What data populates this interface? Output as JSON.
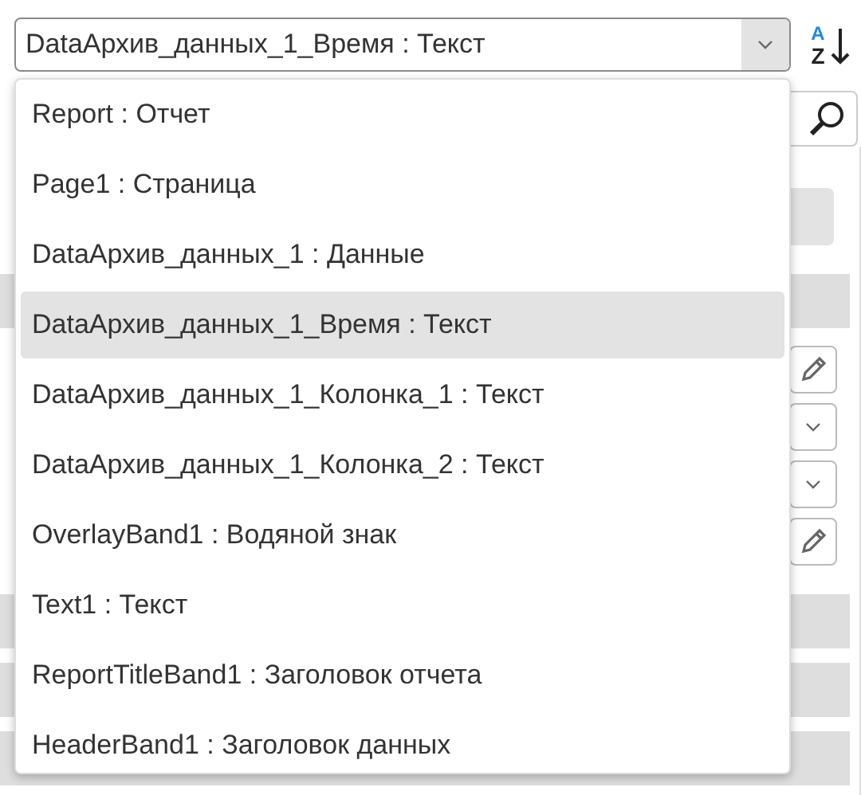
{
  "object_selector": {
    "value": "DataАрхив_данных_1_Время : Текст",
    "expanded": true,
    "options": [
      {
        "label": "Report : Отчет",
        "selected": false
      },
      {
        "label": "Page1 : Страница",
        "selected": false
      },
      {
        "label": "DataАрхив_данных_1 : Данные",
        "selected": false
      },
      {
        "label": "DataАрхив_данных_1_Время : Текст",
        "selected": true
      },
      {
        "label": "DataАрхив_данных_1_Колонка_1 : Текст",
        "selected": false
      },
      {
        "label": "DataАрхив_данных_1_Колонка_2 : Текст",
        "selected": false
      },
      {
        "label": "OverlayBand1 : Водяной знак",
        "selected": false
      },
      {
        "label": "Text1 : Текст",
        "selected": false
      },
      {
        "label": "ReportTitleBand1 : Заголовок отчета",
        "selected": false
      },
      {
        "label": "HeaderBand1 : Заголовок данных",
        "selected": false
      }
    ]
  },
  "sort_button": {
    "top_letter": "A",
    "bottom_letter": "Z"
  },
  "property_grid": {
    "rows": [
      {
        "kind": "button"
      },
      {
        "kind": "category"
      },
      {
        "kind": "edit"
      },
      {
        "kind": "dropdown"
      },
      {
        "kind": "dropdown"
      },
      {
        "kind": "edit"
      },
      {
        "kind": "category"
      },
      {
        "kind": "category"
      },
      {
        "kind": "category"
      }
    ]
  }
}
